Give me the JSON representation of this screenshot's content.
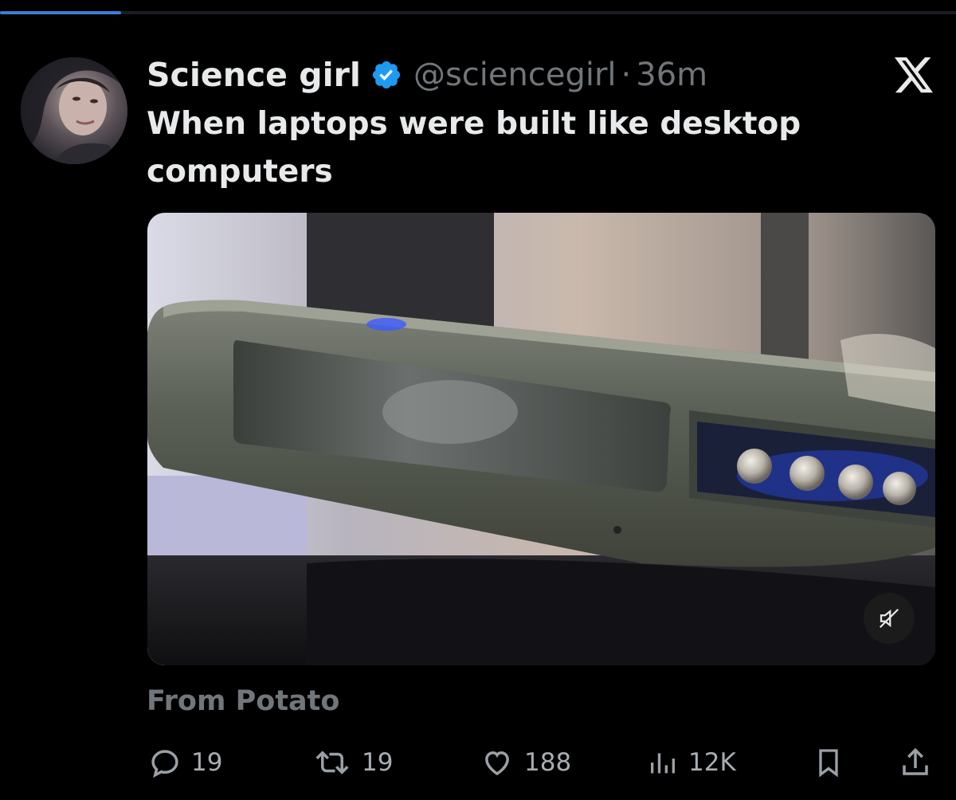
{
  "tweet": {
    "author_name": "Science girl",
    "handle": "@sciencegirl",
    "separator": "·",
    "time": "36m",
    "text": "When laptops were built like desktop computers",
    "attribution": "From Potato"
  },
  "video": {
    "progress_fraction": 0.127,
    "muted": true
  },
  "actions": {
    "replies": "19",
    "reposts": "19",
    "likes": "188",
    "views": "12K"
  },
  "icons": {
    "verified": "verified-badge-icon",
    "x_logo": "x-logo-icon",
    "reply": "reply-icon",
    "repost": "repost-icon",
    "like": "heart-icon",
    "views": "views-chart-icon",
    "bookmark": "bookmark-icon",
    "share": "share-icon",
    "mute": "muted-speaker-icon"
  },
  "colors": {
    "background": "#000000",
    "accent": "#1d9bf0",
    "text_primary": "#e7e9ea",
    "text_secondary": "#71767b"
  }
}
